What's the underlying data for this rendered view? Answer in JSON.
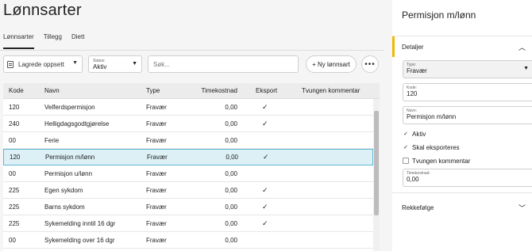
{
  "page": {
    "title": "Lønnsarter"
  },
  "tabs": [
    {
      "label": "Lønnsarter",
      "active": true
    },
    {
      "label": "Tillegg",
      "active": false
    },
    {
      "label": "Diett",
      "active": false
    }
  ],
  "toolbar": {
    "saved_views_label": "Lagrede oppsett",
    "status_label": "Status:",
    "status_value": "Aktiv",
    "search_placeholder": "Søk...",
    "new_button_label": "+ Ny lønnsart",
    "more_label": "•••"
  },
  "table": {
    "headers": [
      "Kode",
      "Navn",
      "Type",
      "Timekostnad",
      "Eksport",
      "Tvungen kommentar"
    ],
    "rows": [
      {
        "kode": "120",
        "navn": "Velferdspermisjon",
        "type": "Fravær",
        "timekostnad": "0,00",
        "eksport": true,
        "selected": false
      },
      {
        "kode": "240",
        "navn": "Helligdagsgodtgjørelse",
        "type": "Fravær",
        "timekostnad": "0,00",
        "eksport": true,
        "selected": false
      },
      {
        "kode": "00",
        "navn": "Ferie",
        "type": "Fravær",
        "timekostnad": "0,00",
        "eksport": false,
        "selected": false
      },
      {
        "kode": "120",
        "navn": "Permisjon m/lønn",
        "type": "Fravær",
        "timekostnad": "0,00",
        "eksport": true,
        "selected": true
      },
      {
        "kode": "00",
        "navn": "Permisjon u/lønn",
        "type": "Fravær",
        "timekostnad": "0,00",
        "eksport": false,
        "selected": false
      },
      {
        "kode": "225",
        "navn": "Egen sykdom",
        "type": "Fravær",
        "timekostnad": "0,00",
        "eksport": true,
        "selected": false
      },
      {
        "kode": "225",
        "navn": "Barns sykdom",
        "type": "Fravær",
        "timekostnad": "0,00",
        "eksport": true,
        "selected": false
      },
      {
        "kode": "225",
        "navn": "Sykemelding inntil 16 dgr",
        "type": "Fravær",
        "timekostnad": "0,00",
        "eksport": true,
        "selected": false
      },
      {
        "kode": "00",
        "navn": "Sykemelding over 16 dgr",
        "type": "Fravær",
        "timekostnad": "0,00",
        "eksport": false,
        "selected": false
      }
    ],
    "check_glyph": "✓"
  },
  "panel": {
    "title": "Permisjon m/lønn",
    "details_label": "Detaljer",
    "type_label": "Type:",
    "type_value": "Fravær",
    "kode_label": "Kode:",
    "kode_value": "120",
    "navn_label": "Navn:",
    "navn_value": "Permisjon m/lønn",
    "aktiv_label": "Aktiv",
    "aktiv_checked": true,
    "eksport_label": "Skal eksporteres",
    "eksport_checked": true,
    "tvungen_label": "Tvungen kommentar",
    "tvungen_checked": false,
    "timekostnad_label": "Timekostnad:",
    "timekostnad_value": "0,00",
    "rekkefolge_label": "Rekkefølge"
  },
  "colors": {
    "accent": "#f2b700",
    "selected_row": "#dcf0f6",
    "selected_border": "#5fb7d4"
  }
}
